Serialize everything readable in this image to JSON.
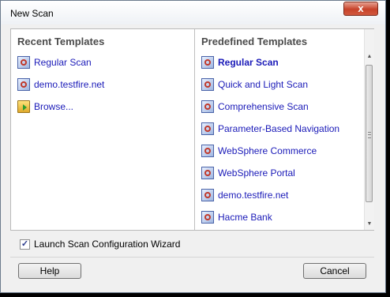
{
  "window": {
    "title": "New Scan",
    "close_glyph": "x"
  },
  "recent": {
    "title": "Recent Templates",
    "items": [
      {
        "label": "Regular Scan",
        "icon": "template-icon"
      },
      {
        "label": "demo.testfire.net",
        "icon": "template-icon"
      },
      {
        "label": "Browse...",
        "icon": "folder-open-icon"
      }
    ]
  },
  "predefined": {
    "title": "Predefined Templates",
    "items": [
      {
        "label": "Regular Scan",
        "selected": true
      },
      {
        "label": "Quick and Light Scan"
      },
      {
        "label": "Comprehensive Scan"
      },
      {
        "label": "Parameter-Based Navigation"
      },
      {
        "label": "WebSphere Commerce"
      },
      {
        "label": "WebSphere Portal"
      },
      {
        "label": "demo.testfire.net"
      },
      {
        "label": "Hacme Bank"
      }
    ]
  },
  "scrollbar": {
    "up_glyph": "▲",
    "down_glyph": "▼"
  },
  "options": {
    "wizard_checkbox_label": "Launch Scan Configuration Wizard",
    "wizard_checked": true,
    "check_glyph": "✓"
  },
  "footer": {
    "help_label": "Help",
    "cancel_label": "Cancel"
  },
  "colors": {
    "link": "#1a1ab8",
    "section_title": "#4b4b4b",
    "close_button": "#c7432a"
  }
}
